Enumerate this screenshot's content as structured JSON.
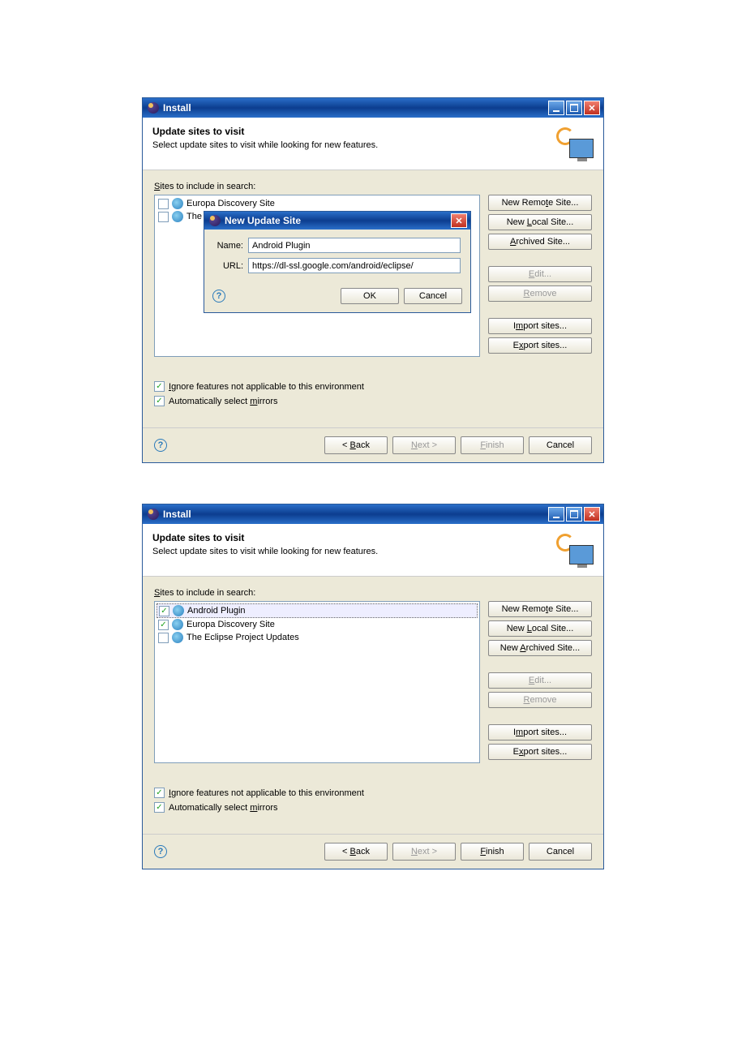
{
  "window1": {
    "title": "Install",
    "header": {
      "heading": "Update sites to visit",
      "sub": "Select update sites to visit while looking for new features."
    },
    "sites_label_pre": "S",
    "sites_label_post": "ites to include in search:",
    "sites": [
      {
        "checked": false,
        "label": "Europa Discovery Site"
      },
      {
        "checked": false,
        "label": "The Eclipse Project Updates"
      }
    ],
    "buttons": {
      "remote": "New Remote Site...",
      "remote_u": "t",
      "local": "New Local Site...",
      "local_u": "L",
      "archived": "Archived Site...",
      "archived_pre": "",
      "archived_u": "A",
      "edit": "Edit...",
      "edit_u": "E",
      "remove": "Remove",
      "remove_u": "R",
      "import": "Import sites...",
      "import_u": "m",
      "export": "Export sites...",
      "export_u": "x"
    },
    "checks": {
      "ignore_pre": "I",
      "ignore": "gnore features not applicable to this environment",
      "mirrors": "Automatically select ",
      "mirrors_u": "m",
      "mirrors_post": "irrors"
    },
    "footer": {
      "back": "< Back",
      "back_u": "B",
      "next": "Next >",
      "next_u": "N",
      "finish": "Finish",
      "finish_u": "F",
      "cancel": "Cancel"
    },
    "modal": {
      "title": "New Update Site",
      "name_label": "Name:",
      "name_value": "Android Plugin",
      "url_label": "URL:",
      "url_value": "https://dl-ssl.google.com/android/eclipse/",
      "ok": "OK",
      "cancel": "Cancel"
    }
  },
  "window2": {
    "title": "Install",
    "header": {
      "heading": "Update sites to visit",
      "sub": "Select update sites to visit while looking for new features."
    },
    "sites_label_pre": "S",
    "sites_label_post": "ites to include in search:",
    "sites": [
      {
        "checked": true,
        "label": "Android Plugin",
        "selected": true
      },
      {
        "checked": true,
        "label": "Europa Discovery Site"
      },
      {
        "checked": false,
        "label": "The Eclipse Project Updates"
      }
    ],
    "buttons": {
      "remote": "New Remote Site...",
      "local": "New Local Site...",
      "archived": "New Archived Site...",
      "edit": "Edit...",
      "remove": "Remove",
      "import": "Import sites...",
      "export": "Export sites..."
    },
    "checks": {
      "ignore_pre": "I",
      "ignore": "gnore features not applicable to this environment",
      "mirrors": "Automatically select ",
      "mirrors_u": "m",
      "mirrors_post": "irrors"
    },
    "footer": {
      "back": "< Back",
      "next": "Next >",
      "finish": "Finish",
      "cancel": "Cancel"
    }
  }
}
